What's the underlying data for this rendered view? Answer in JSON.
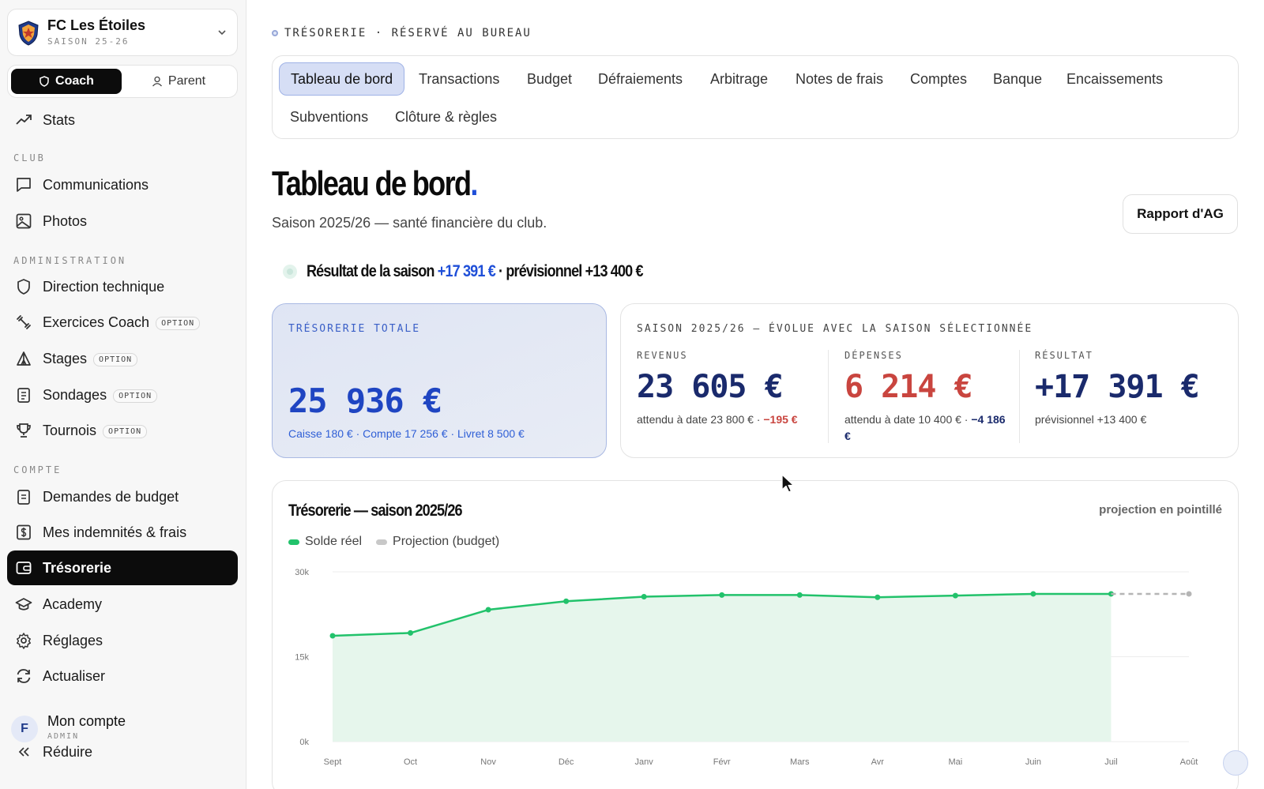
{
  "club": {
    "name": "FC Les Étoiles",
    "season": "SAISON 25-26"
  },
  "roles": {
    "coach": "Coach",
    "parent": "Parent"
  },
  "nav": {
    "stats": "Stats",
    "section_club": "CLUB",
    "communications": "Communications",
    "photos": "Photos",
    "section_admin": "ADMINISTRATION",
    "direction": "Direction technique",
    "exercices": "Exercices Coach",
    "stages": "Stages",
    "sondages": "Sondages",
    "tournois": "Tournois",
    "option_badge": "OPTION",
    "section_compte": "COMPTE",
    "demandes": "Demandes de budget",
    "indemnites": "Mes indemnités & frais",
    "tresorerie": "Trésorerie",
    "academy": "Academy",
    "reglages": "Réglages",
    "actualiser": "Actualiser",
    "reduire": "Réduire"
  },
  "account": {
    "initial": "F",
    "name": "Mon compte",
    "role": "ADMIN"
  },
  "header": {
    "eyebrow": "TRÉSORERIE · RÉSERVÉ AU BUREAU"
  },
  "tabs": [
    "Tableau de bord",
    "Transactions",
    "Budget",
    "Défraiements",
    "Arbitrage",
    "Notes de frais",
    "Comptes",
    "Banque",
    "Encaissements",
    "Subventions",
    "Clôture & règles"
  ],
  "page": {
    "title": "Tableau de bord",
    "title_dot": ".",
    "subtitle": "Saison 2025/26 — santé financière du club.",
    "ag_button": "Rapport d'AG"
  },
  "result": {
    "prefix": "Résultat de la saison",
    "value": "+17 391 €",
    "suffix": "· prévisionnel +13 400 €"
  },
  "treso": {
    "label": "TRÉSORERIE TOTALE",
    "amount": "25 936 €",
    "detail": "Caisse 180 € · Compte 17 256 € · Livret 8 500 €"
  },
  "season_card": {
    "label": "SAISON 2025/26 — ÉVOLUE AVEC LA SAISON SÉLECTIONNÉE",
    "revenus": {
      "h": "REVENUS",
      "v": "23 605 €",
      "s": "attendu à date 23 800 € ·",
      "delta": "−195 €"
    },
    "depenses": {
      "h": "DÉPENSES",
      "v": "6 214 €",
      "s": "attendu à date 10 400 € ·",
      "delta": "−4 186 €"
    },
    "resultat": {
      "h": "RÉSULTAT",
      "v": "+17 391 €",
      "s": "prévisionnel +13 400 €"
    }
  },
  "chart": {
    "title": "Trésorerie — saison 2025/26",
    "note": "projection en pointillé",
    "legend_real": "Solde réel",
    "legend_proj": "Projection (budget)"
  },
  "colors": {
    "accent": "#1f4fd8",
    "real": "#22c26b",
    "real_fill": "#e6f6ec",
    "projection": "#c8c8c8",
    "expense": "#c9453f",
    "navy": "#1a2a6c"
  },
  "chart_data": {
    "type": "line",
    "categories": [
      "Sept",
      "Oct",
      "Nov",
      "Déc",
      "Janv",
      "Févr",
      "Mars",
      "Avr",
      "Mai",
      "Juin",
      "Juil",
      "Août"
    ],
    "series": [
      {
        "name": "Solde réel",
        "values": [
          18700,
          19200,
          23300,
          24800,
          25600,
          25900,
          25900,
          25500,
          25800,
          26100,
          26100,
          null
        ]
      },
      {
        "name": "Projection (budget)",
        "values": [
          null,
          null,
          null,
          null,
          null,
          null,
          null,
          null,
          null,
          null,
          26100,
          26100
        ]
      }
    ],
    "yticks": [
      0,
      15000,
      30000
    ],
    "ytick_labels": [
      "0k",
      "15k",
      "30k"
    ],
    "ylim": [
      0,
      30000
    ],
    "grid": true,
    "legend": "top-left"
  }
}
